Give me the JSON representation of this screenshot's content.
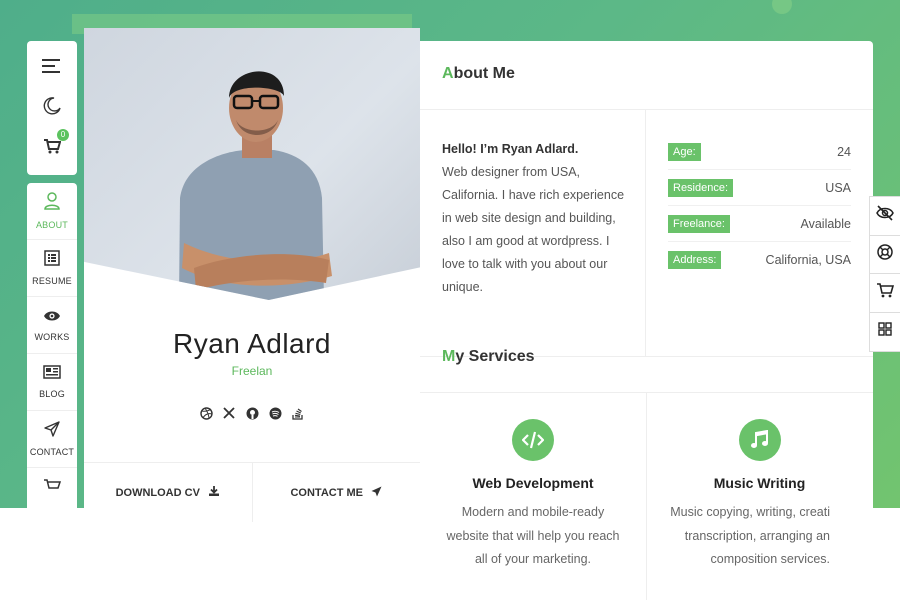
{
  "nav_top": {
    "cart_count": "0"
  },
  "nav": {
    "items": [
      {
        "label": "ABOUT",
        "icon": "user-icon"
      },
      {
        "label": "RESUME",
        "icon": "resume-icon"
      },
      {
        "label": "WORKS",
        "icon": "eye-icon"
      },
      {
        "label": "BLOG",
        "icon": "newspaper-icon"
      },
      {
        "label": "CONTACT",
        "icon": "send-icon"
      }
    ]
  },
  "profile": {
    "name": "Ryan Adlard",
    "role": "Freelan",
    "socials": [
      "dribbble-icon",
      "x-icon",
      "github-icon",
      "spotify-icon",
      "stackoverflow-icon"
    ],
    "download_label": "DOWNLOAD CV",
    "contact_label": "CONTACT ME"
  },
  "about": {
    "title_first": "A",
    "title_rest": "bout Me",
    "hello": "Hello! I’m Ryan Adlard.",
    "lines": [
      "Web designer from USA,",
      "California. I have rich experience",
      "in web site design and building,",
      "also I am good at wordpress. I",
      "love to talk with you about our",
      "unique."
    ],
    "info": [
      {
        "key": "Age:",
        "value": "24"
      },
      {
        "key": "Residence:",
        "value": "USA"
      },
      {
        "key": "Freelance:",
        "value": "Available"
      },
      {
        "key": "Address:",
        "value": "California, USA"
      }
    ]
  },
  "services": {
    "title_first": "M",
    "title_rest": "y Services",
    "items": [
      {
        "title": "Web Development",
        "icon": "code-icon",
        "lines": [
          "Modern and mobile-ready",
          "website that will help you reach",
          "all of your marketing."
        ]
      },
      {
        "title": "Music Writing",
        "icon": "music-icon",
        "lines": [
          "Music copying, writing, creati",
          "transcription, arranging an",
          "composition services."
        ]
      }
    ]
  },
  "colors": {
    "accent": "#5cb85c",
    "gradient_start": "#4fae8a",
    "gradient_end": "#72c46f"
  }
}
